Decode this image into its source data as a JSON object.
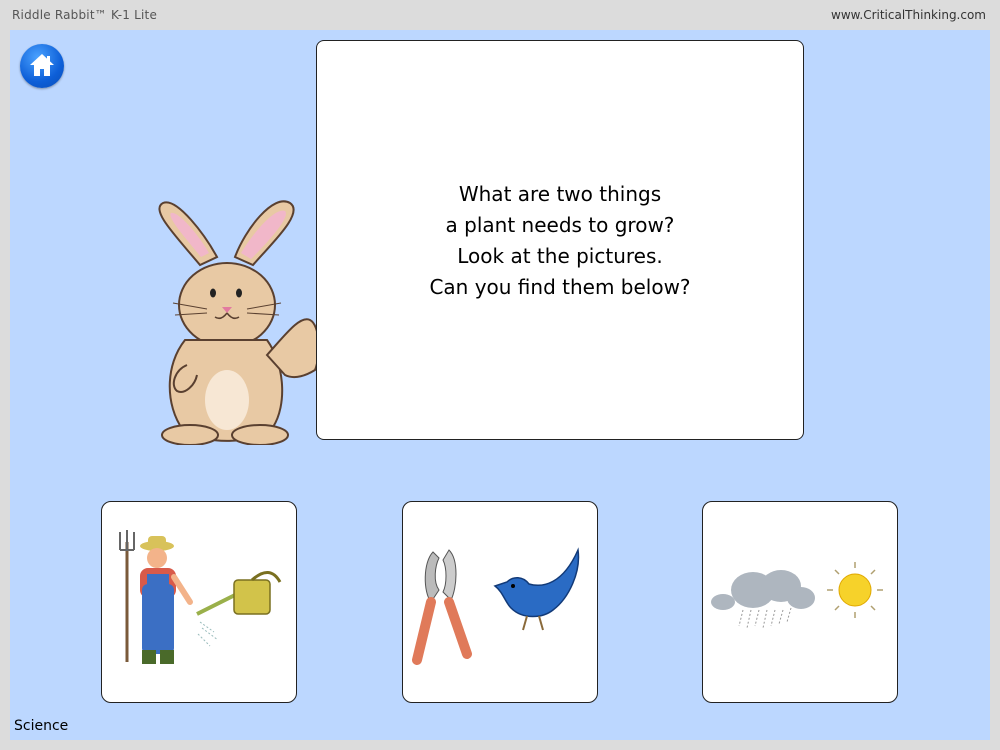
{
  "header": {
    "app_title": "Riddle Rabbit™ K-1 Lite",
    "site": "www.CriticalThinking.com"
  },
  "riddle": {
    "lines": [
      "What are two things",
      "a plant needs to grow?",
      "Look at the pictures.",
      "Can you find them below?"
    ]
  },
  "choices": [
    {
      "icons": [
        "farmer-icon",
        "watering-can-icon"
      ]
    },
    {
      "icons": [
        "pruning-shears-icon",
        "bird-icon"
      ]
    },
    {
      "icons": [
        "rain-cloud-icon",
        "sun-icon"
      ]
    }
  ],
  "footer": {
    "subject": "Science"
  },
  "colors": {
    "background": "#bcd7ff",
    "home_button": "#0d5fd8"
  }
}
